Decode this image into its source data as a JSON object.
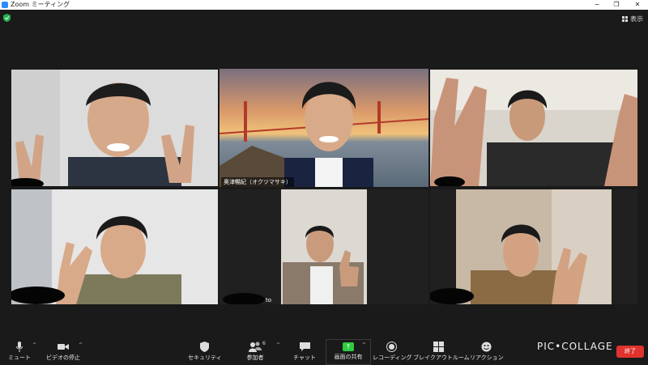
{
  "window": {
    "title": "Zoom ミーティング",
    "controls": [
      "−",
      "❐",
      "✕"
    ]
  },
  "header": {
    "view_label": "表示"
  },
  "participants": [
    {
      "name": "",
      "active": false
    },
    {
      "name": "奥津暢紀（オクツマサキ）",
      "active": true
    },
    {
      "name": "",
      "active": false
    },
    {
      "name": "",
      "active": false
    },
    {
      "name": "to",
      "active": false
    },
    {
      "name": "",
      "active": false
    }
  ],
  "toolbar": {
    "mute": "ミュート",
    "stop_video": "ビデオの停止",
    "security": "セキュリティ",
    "participants": "参加者",
    "participants_count": "6",
    "chat": "チャット",
    "share_screen": "画面の共有",
    "recording": "レコーディング",
    "breakout": "ブレイクアウトルーム",
    "reactions": "リアクション",
    "end": "終了"
  },
  "watermark": "PIC•COLLAGE",
  "colors": {
    "background": "#1a1a1a",
    "active_speaker": "#c8e05a",
    "share_green": "#2ecc40",
    "end_red": "#e0332d"
  }
}
